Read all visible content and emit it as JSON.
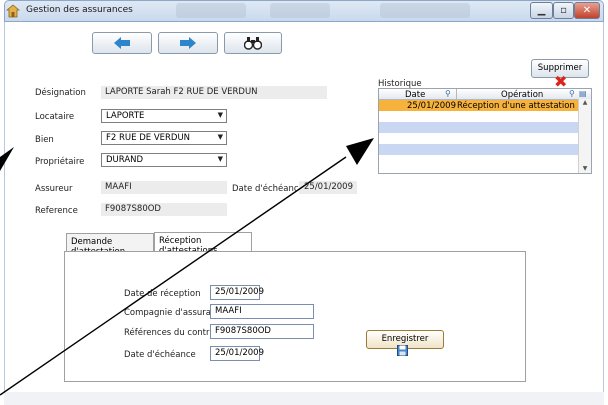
{
  "window": {
    "title": "Gestion des assurances",
    "minimize_icon": "minimize-icon",
    "maximize_icon": "maximize-icon",
    "close_icon": "close-icon"
  },
  "toolbar": {
    "prev_icon": "arrow-left-icon",
    "next_icon": "arrow-right-icon",
    "search_icon": "binoculars-icon"
  },
  "form": {
    "designation_label": "Désignation",
    "designation_value": "LAPORTE Sarah F2 RUE DE VERDUN",
    "locataire_label": "Locataire",
    "locataire_value": "LAPORTE",
    "bien_label": "Bien",
    "bien_value": "F2 RUE DE VERDUN",
    "proprietaire_label": "Propriétaire",
    "proprietaire_value": "DURAND",
    "assureur_label": "Assureur",
    "assureur_value": "MAAFI",
    "echeance_label": "Date d'échéance",
    "echeance_value": "25/01/2009",
    "reference_label": "Reference",
    "reference_value": "F9087S80OD"
  },
  "historique": {
    "title": "Historique",
    "col_date": "Date",
    "col_operation": "Opération",
    "rows": [
      {
        "date": "25/01/2009",
        "operation": "Réception d'une attestation"
      }
    ]
  },
  "delete_button": {
    "label": "Supprimer",
    "icon": "red-cross-icon"
  },
  "tabs": [
    {
      "label": "Demande d'attestation"
    },
    {
      "label": "Réception d'attestations"
    }
  ],
  "reception": {
    "date_reception_label": "Date de réception",
    "date_reception_value": "25/01/2009",
    "compagnie_label": "Compagnie d'assurance",
    "compagnie_value": "MAAFI",
    "references_label": "Références du contrat",
    "references_value": "F9087S80OD",
    "echeance_label": "Date d'échéance",
    "echeance_value": "25/01/2009",
    "save_label": "Enregistrer",
    "save_icon": "floppy-disk-icon"
  },
  "colors": {
    "selected_row": "#f7b23b",
    "stripe_row": "#c9d7f2",
    "annotation_arrow": "#000000"
  }
}
